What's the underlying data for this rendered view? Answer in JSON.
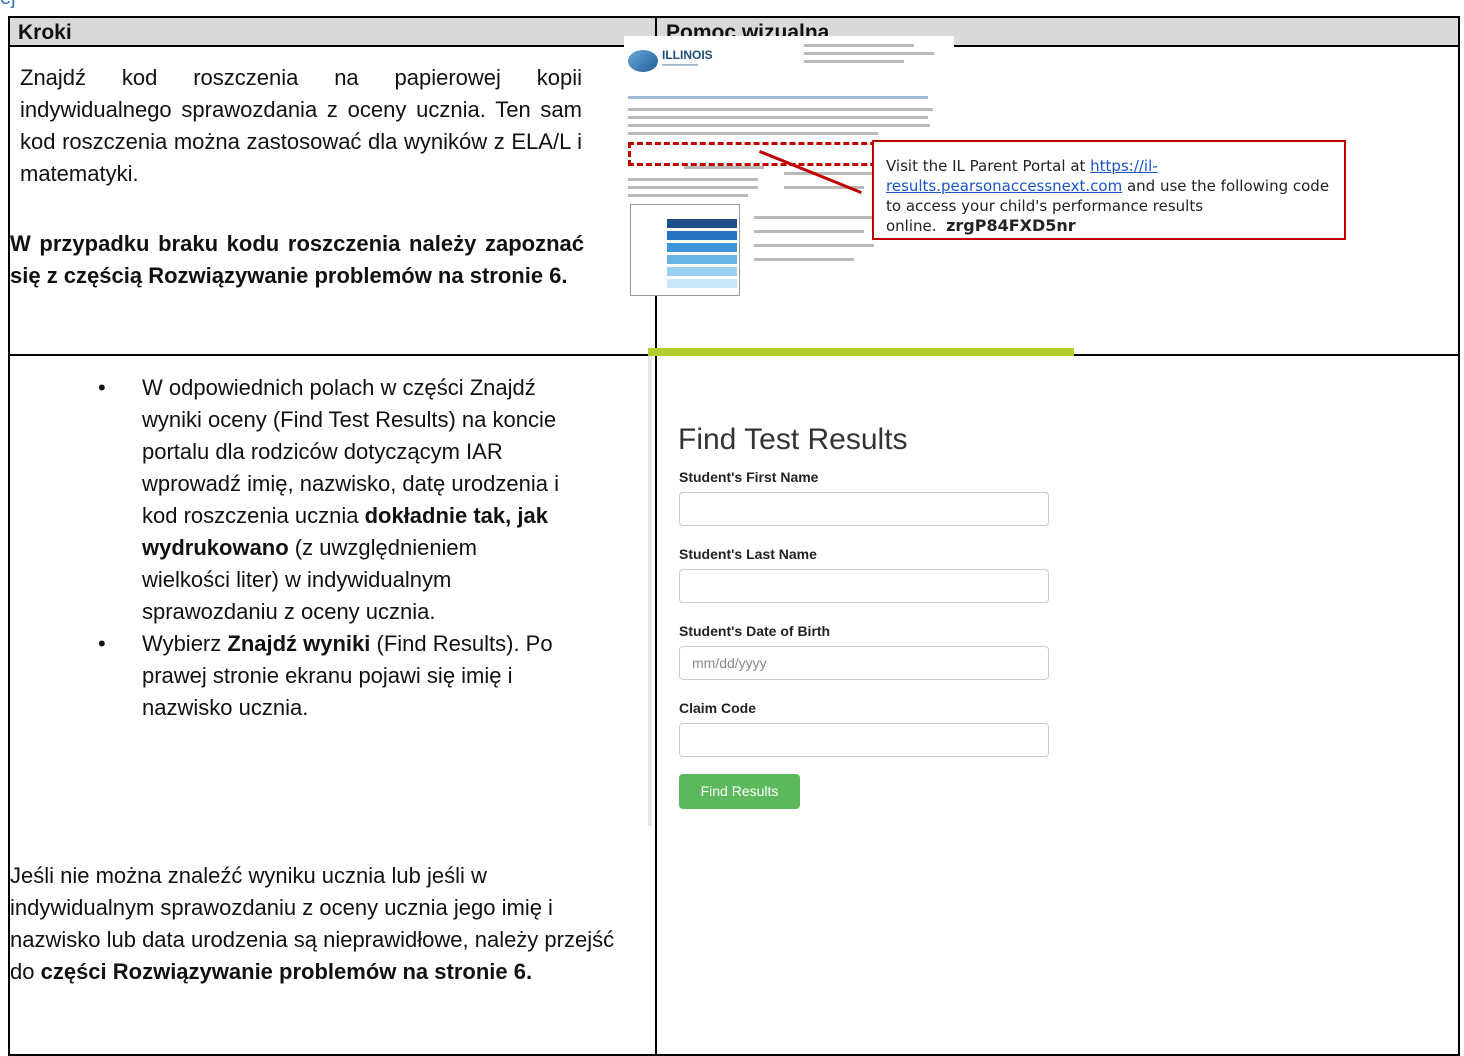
{
  "table": {
    "headers": {
      "steps": "Kroki",
      "visual": "Pomoc wizualna"
    },
    "row1": {
      "text": "Znajdź kod roszczenia na papierowej kopii indywidualnego sprawozdania z oceny ucznia. Ten sam kod roszczenia można zastosować dla wyników z ELA/L i matematyki.",
      "bold_note": "W przypadku braku kodu roszczenia należy zapoznać się z częścią Rozwiązywanie problemów na stronie 6."
    },
    "row2": {
      "bullet1": {
        "part1": "W odpowiednich polach w części Znajdź wyniki oceny (Find Test Results) na koncie portalu dla rodziców dotyczącym IAR wprowadź imię, nazwisko, datę urodzenia i kod roszczenia ucznia ",
        "bold": "dokładnie tak, jak wydrukowano",
        "part2": " (z uwzględnieniem wielkości liter) w indywidualnym sprawozdaniu z oceny ucznia."
      },
      "bullet2": {
        "part1": "Wybierz ",
        "bold": "Znajdź wyniki",
        "part2": " (Find Results). Po prawej stronie ekranu pojawi się imię i nazwisko ucznia."
      },
      "footer": {
        "part1": "Jeśli nie można znaleźć wyniku ucznia lub jeśli w indywidualnym sprawozdaniu z oceny ucznia jego imię i nazwisko lub data urodzenia są nieprawidłowe, należy przejść do ",
        "bold": "części Rozwiązywanie problemów na stronie 6."
      }
    }
  },
  "report_image": {
    "logo_text": "ILLINOIS",
    "callout": {
      "prefix": "Visit the IL Parent Portal at ",
      "link": "https://il-results.pearsonaccessnext.com",
      "suffix": " and use the following code to access your child's performance results online.",
      "code": "zrgP84FXD5nr"
    }
  },
  "form": {
    "title": "Find Test Results",
    "fields": [
      {
        "label": "Student's First Name",
        "placeholder": ""
      },
      {
        "label": "Student's Last Name",
        "placeholder": ""
      },
      {
        "label": "Student's Date of Birth",
        "placeholder": "mm/dd/yyyy"
      },
      {
        "label": "Claim Code",
        "placeholder": ""
      }
    ],
    "button": "Find Results"
  },
  "colors": {
    "header_bg": "#d9d9d9",
    "accent_bar": "#b5cc2d",
    "button_green": "#5cb85c",
    "callout_red": "#c00000"
  }
}
